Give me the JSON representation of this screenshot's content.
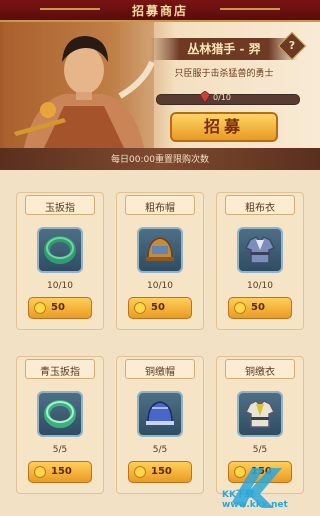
{
  "header": {
    "title": "招募商店"
  },
  "hero": {
    "name": "丛林猎手 - 羿",
    "description": "只臣服于击杀猛兽的勇士",
    "progress_text": "0/10",
    "progress": 0.0,
    "recruit_label": "招募",
    "help_label": "?"
  },
  "reset_notice": "每日00:00重置限购次数",
  "items": [
    {
      "name": "玉扳指",
      "count": "10/10",
      "price": "50",
      "icon": "jade-ring-icon",
      "color": "#2f9e6e"
    },
    {
      "name": "粗布帽",
      "count": "10/10",
      "price": "50",
      "icon": "cloth-hat-icon",
      "color": "#c78a3a"
    },
    {
      "name": "粗布衣",
      "count": "10/10",
      "price": "50",
      "icon": "cloth-armor-icon",
      "color": "#7d8fb8"
    },
    {
      "name": "青玉扳指",
      "count": "5/5",
      "price": "150",
      "icon": "green-jade-ring-icon",
      "color": "#3bb07e"
    },
    {
      "name": "铜缴帽",
      "count": "5/5",
      "price": "150",
      "icon": "copper-hat-icon",
      "color": "#4a66c8"
    },
    {
      "name": "铜缴衣",
      "count": "5/5",
      "price": "150",
      "icon": "copper-armor-icon",
      "color": "#d8c23a"
    }
  ],
  "watermark": "KK下载 www.kkx.net"
}
